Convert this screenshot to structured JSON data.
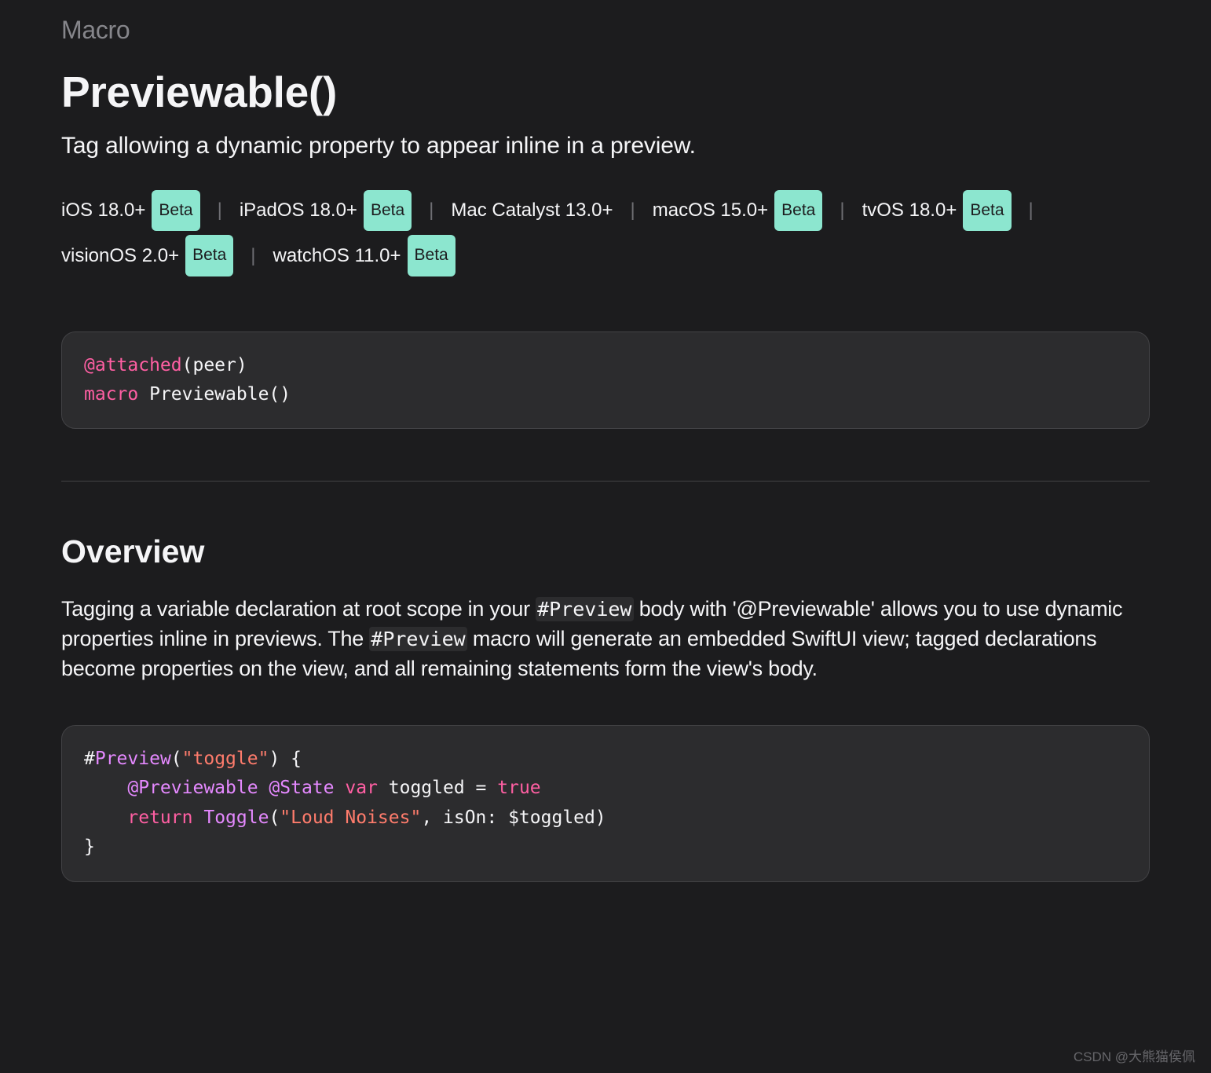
{
  "category": "Macro",
  "title": "Previewable()",
  "summary": "Tag allowing a dynamic property to appear inline in a preview.",
  "platforms": [
    {
      "name": "iOS 18.0+",
      "beta": true
    },
    {
      "name": "iPadOS 18.0+",
      "beta": true
    },
    {
      "name": "Mac Catalyst 13.0+",
      "beta": false
    },
    {
      "name": "macOS 15.0+",
      "beta": true
    },
    {
      "name": "tvOS 18.0+",
      "beta": true
    },
    {
      "name": "visionOS 2.0+",
      "beta": true
    },
    {
      "name": "watchOS 11.0+",
      "beta": true
    }
  ],
  "beta_label": "Beta",
  "declaration": {
    "attr_attached": "@attached",
    "attached_args": "(peer)",
    "macro_kw": "macro",
    "macro_name": " Previewable()"
  },
  "overview": {
    "heading": "Overview",
    "p1_a": "Tagging a variable declaration at root scope in your ",
    "p1_code1": "#Preview",
    "p1_b": " body with '@Previewable' allows you to use dynamic properties inline in previews. The ",
    "p1_code2": "#Preview",
    "p1_c": " macro will generate an embedded SwiftUI view; tagged declarations become properties on the view, and all remaining statements form the view's body."
  },
  "example": {
    "hash": "#",
    "preview": "Preview",
    "paren_open": "(",
    "str_toggle": "\"toggle\"",
    "paren_close_brace": ") {",
    "indent": "    ",
    "at_previewable": "@Previewable",
    "space": " ",
    "at_state": "@State",
    "var_kw": "var",
    "toggled_eq": " toggled = ",
    "true_kw": "true",
    "return_kw": "return",
    "toggle_type": "Toggle",
    "str_loud": "\"Loud Noises\"",
    "ison_rest": ", isOn: $toggled)",
    "brace_close": "}"
  },
  "watermark": "CSDN @大熊猫侯佩"
}
